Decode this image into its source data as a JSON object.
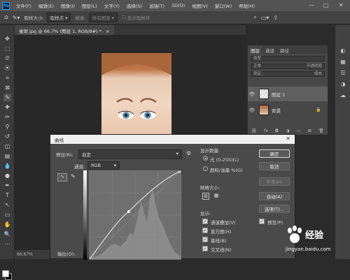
{
  "app": {
    "logo": "Ps"
  },
  "menu": [
    "文件(F)",
    "编辑(E)",
    "图像(I)",
    "图层(L)",
    "文字(Y)",
    "选择(S)",
    "滤镜(T)",
    "3D(D)",
    "视图(V)",
    "窗口(W)",
    "帮助(H)"
  ],
  "window_controls": {
    "minimize": "—",
    "maximize": "□",
    "close": "✕"
  },
  "options_bar": {
    "sample_size_label": "取样大小:",
    "sample_size_value": "取样点",
    "sample_value": "所有图层",
    "show_ring_label": "显示取样环"
  },
  "document_tab": {
    "title": "雀斑.jpg @ 66.7% (图层 1, RGB/8#) *",
    "close": "×"
  },
  "status_bar": {
    "zoom": "66.67%"
  },
  "layers_panel": {
    "tabs": [
      "图层",
      "通道",
      "路径"
    ],
    "kind_filter": "类型",
    "blend_mode": "正常",
    "opacity": "不透明度",
    "lock": "锁定:",
    "fill": "填充",
    "layers": [
      {
        "name": "图层 1",
        "selected": true
      },
      {
        "name": "背景",
        "selected": false
      }
    ]
  },
  "curves_dialog": {
    "title": "曲线",
    "close": "✕",
    "preset_label": "预设(R):",
    "preset_value": "自定",
    "channel_label": "通道:",
    "channel_value": "RGB",
    "output_label": "输出(O):",
    "display_amount_label": "显示数量:",
    "light_option": "光 (0-255)(L)",
    "pigment_option": "颜料/油墨 %(G)",
    "grid_size_label": "网格大小:",
    "show_label": "显示:",
    "show_options": [
      {
        "label": "通道叠加(V)",
        "checked": true
      },
      {
        "label": "直方图(H)",
        "checked": true
      },
      {
        "label": "基线(B)",
        "checked": true
      },
      {
        "label": "交叉线(N)",
        "checked": true
      }
    ],
    "buttons": {
      "ok": "确定",
      "cancel": "取消",
      "smooth": "平滑(M)",
      "auto": "自动(A)",
      "options": "选项(T)..."
    },
    "preview_label": "预览(P)",
    "preview_checked": true
  },
  "watermark": {
    "brand": "Bai",
    "text": "经验",
    "url": "jingyan.baidu.com"
  }
}
